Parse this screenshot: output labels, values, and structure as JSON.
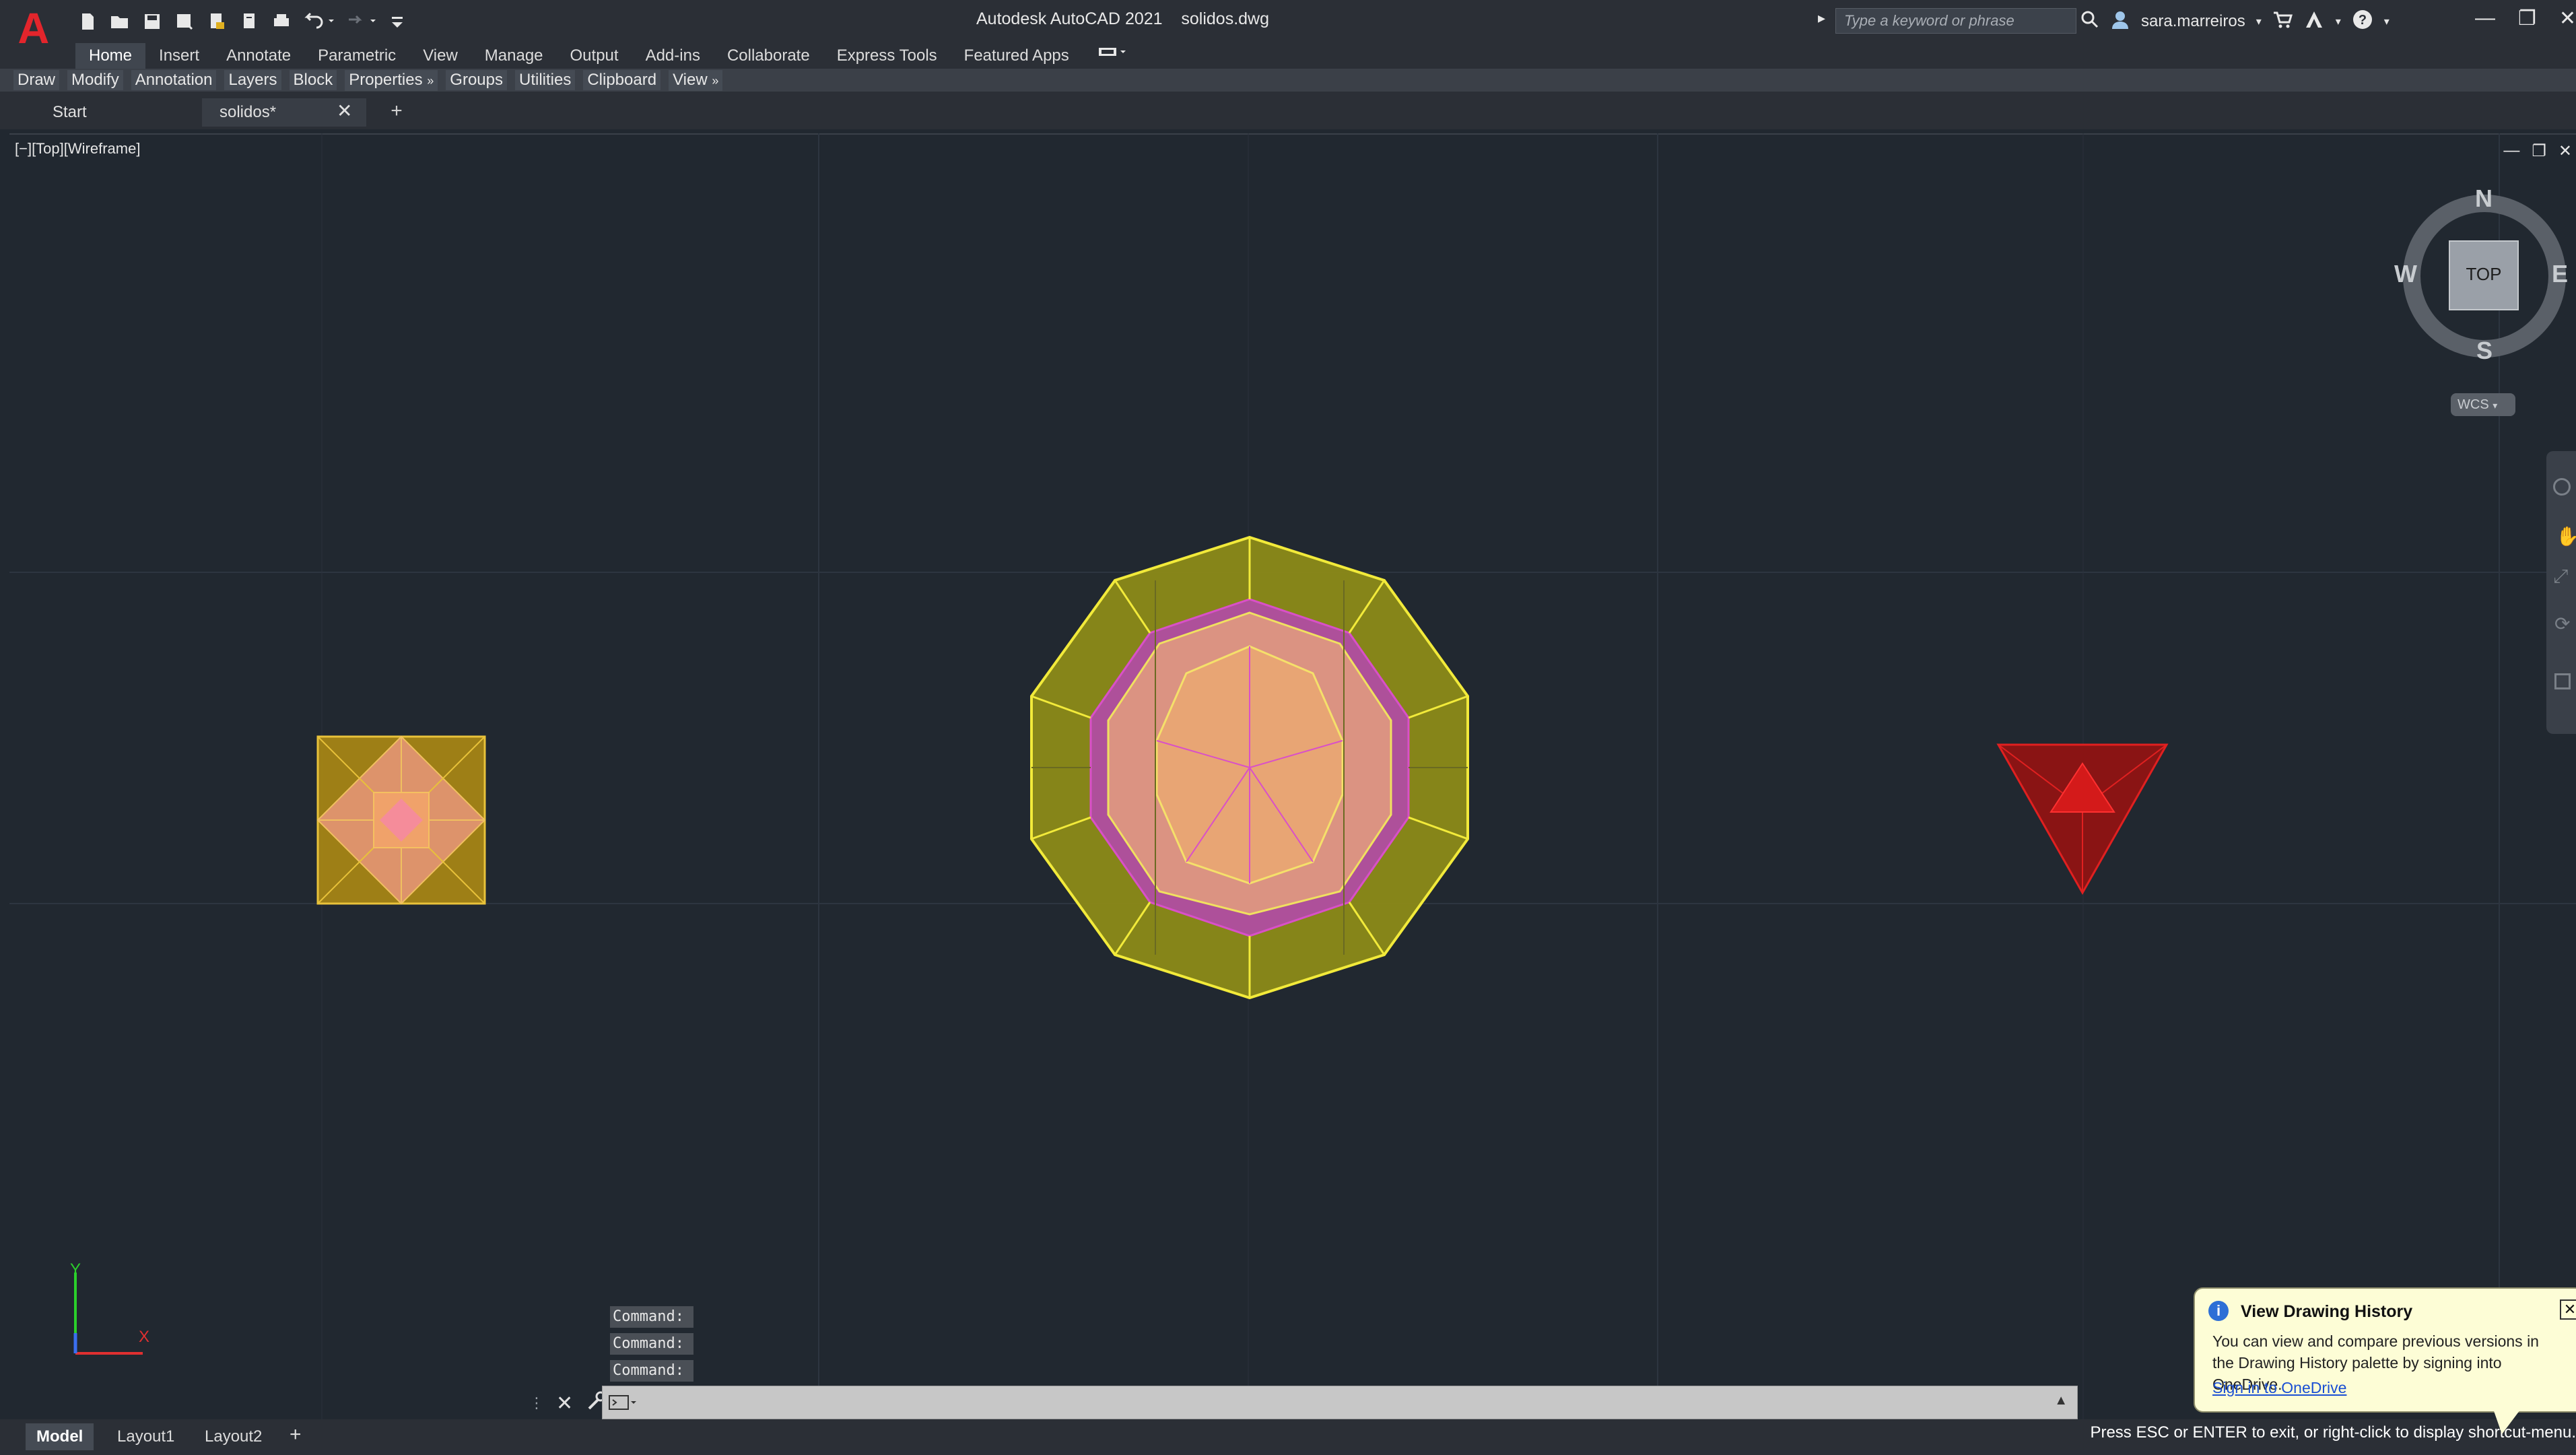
{
  "app": {
    "title": "Autodesk AutoCAD 2021",
    "filename": "solidos.dwg",
    "search_placeholder": "Type a keyword or phrase",
    "user": "sara.marreiros",
    "icons": [
      "new-icon",
      "open-icon",
      "save-icon",
      "save-as-icon",
      "import-icon",
      "export-icon",
      "plot-icon",
      "undo-icon",
      "redo-icon",
      "customize-icon"
    ]
  },
  "ribbon": {
    "tabs": [
      "Home",
      "Insert",
      "Annotate",
      "Parametric",
      "View",
      "Manage",
      "Output",
      "Add-ins",
      "Collaborate",
      "Express Tools",
      "Featured Apps"
    ],
    "active_tab": "Home",
    "panels": [
      "Draw",
      "Modify",
      "Annotation",
      "Layers",
      "Block",
      "Properties",
      "Groups",
      "Utilities",
      "Clipboard",
      "View"
    ]
  },
  "file_tabs": {
    "start": "Start",
    "doc": "solidos*"
  },
  "viewport": {
    "label": "[−][Top][Wireframe]",
    "viewcube": {
      "top_label": "TOP",
      "n": "N",
      "s": "S",
      "e": "E",
      "w": "W",
      "wcs": "WCS"
    },
    "ucs": {
      "x": "X",
      "y": "Y"
    }
  },
  "command": {
    "history": [
      "Command:",
      "Command:",
      "Command:"
    ]
  },
  "layout_tabs": [
    "Model",
    "Layout1",
    "Layout2"
  ],
  "active_layout": "Model",
  "status_text": "Press ESC or ENTER to exit, or right-click to display shortcut-menu.",
  "notification": {
    "title": "View Drawing History",
    "body": "You can view and compare previous versions in the Drawing History palette by signing into OneDrive.",
    "link": "Sign in to OneDrive"
  },
  "colors": {
    "viewport_bg": "#212830",
    "yellow_solid": "#c8c02a",
    "magenta_solid": "#b23fb0",
    "red_solid": "#d11a1a",
    "accent_red": "#e3252c"
  }
}
